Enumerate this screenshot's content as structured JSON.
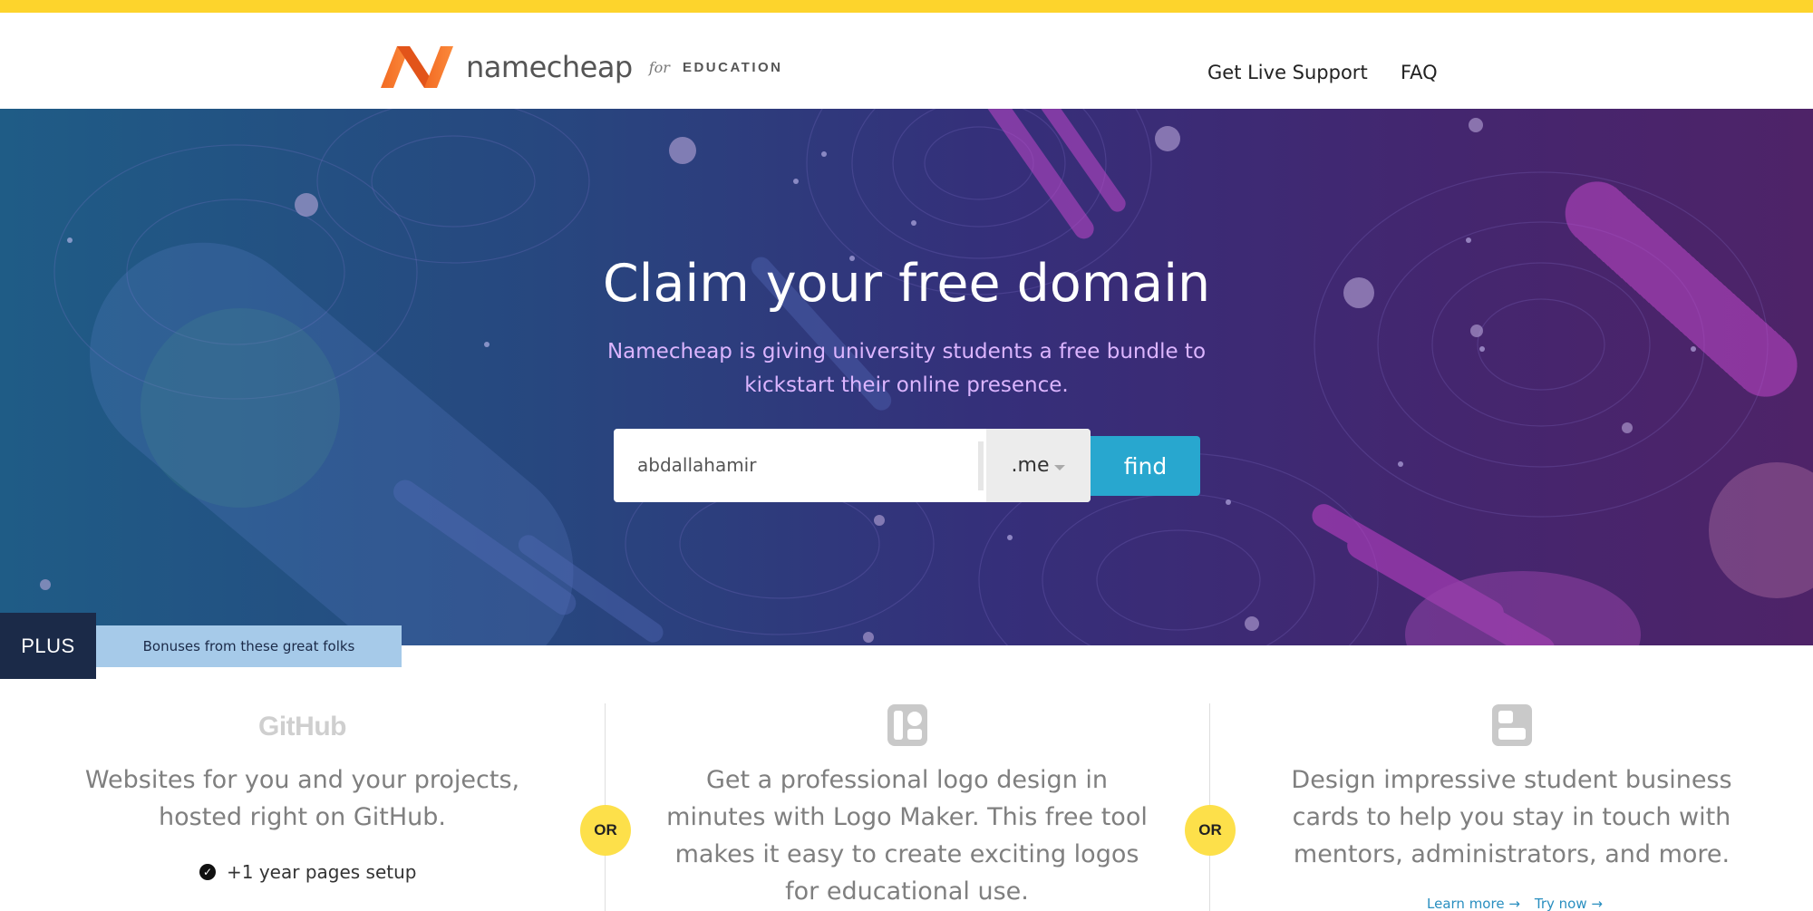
{
  "header": {
    "brand_word": "namecheap",
    "brand_for": "for",
    "brand_edu": "EDUCATION",
    "nav": [
      "Get Live Support",
      "FAQ"
    ]
  },
  "hero": {
    "title": "Claim your free domain",
    "subtitle": "Namecheap is giving university students a free bundle to kickstart their online presence.",
    "search_value": "abdallahamir",
    "tld": ".me",
    "find_label": "find"
  },
  "plus": {
    "badge": "PLUS",
    "note": "Bonuses from these great folks"
  },
  "bonuses": [
    {
      "logo_text": "GitHub",
      "text": "Websites for you and your projects, hosted right on GitHub.",
      "perk": "+1 year pages setup"
    },
    {
      "icon": "logo-maker-icon",
      "text": "Get a professional logo design in minutes with Logo Maker. This free tool makes it easy to create exciting logos for educational use."
    },
    {
      "icon": "business-card-icon",
      "text": "Design impressive student business cards to help you stay in touch with mentors, administrators, and more.",
      "links": [
        "Learn more →",
        "Try now →"
      ]
    }
  ],
  "or_label": "OR",
  "colors": {
    "top_bar": "#fdd42c",
    "find_button": "#28a7cf",
    "plus_badge": "#1b2a48",
    "plus_note": "#a6cae9",
    "or_circle": "#fde04a"
  }
}
